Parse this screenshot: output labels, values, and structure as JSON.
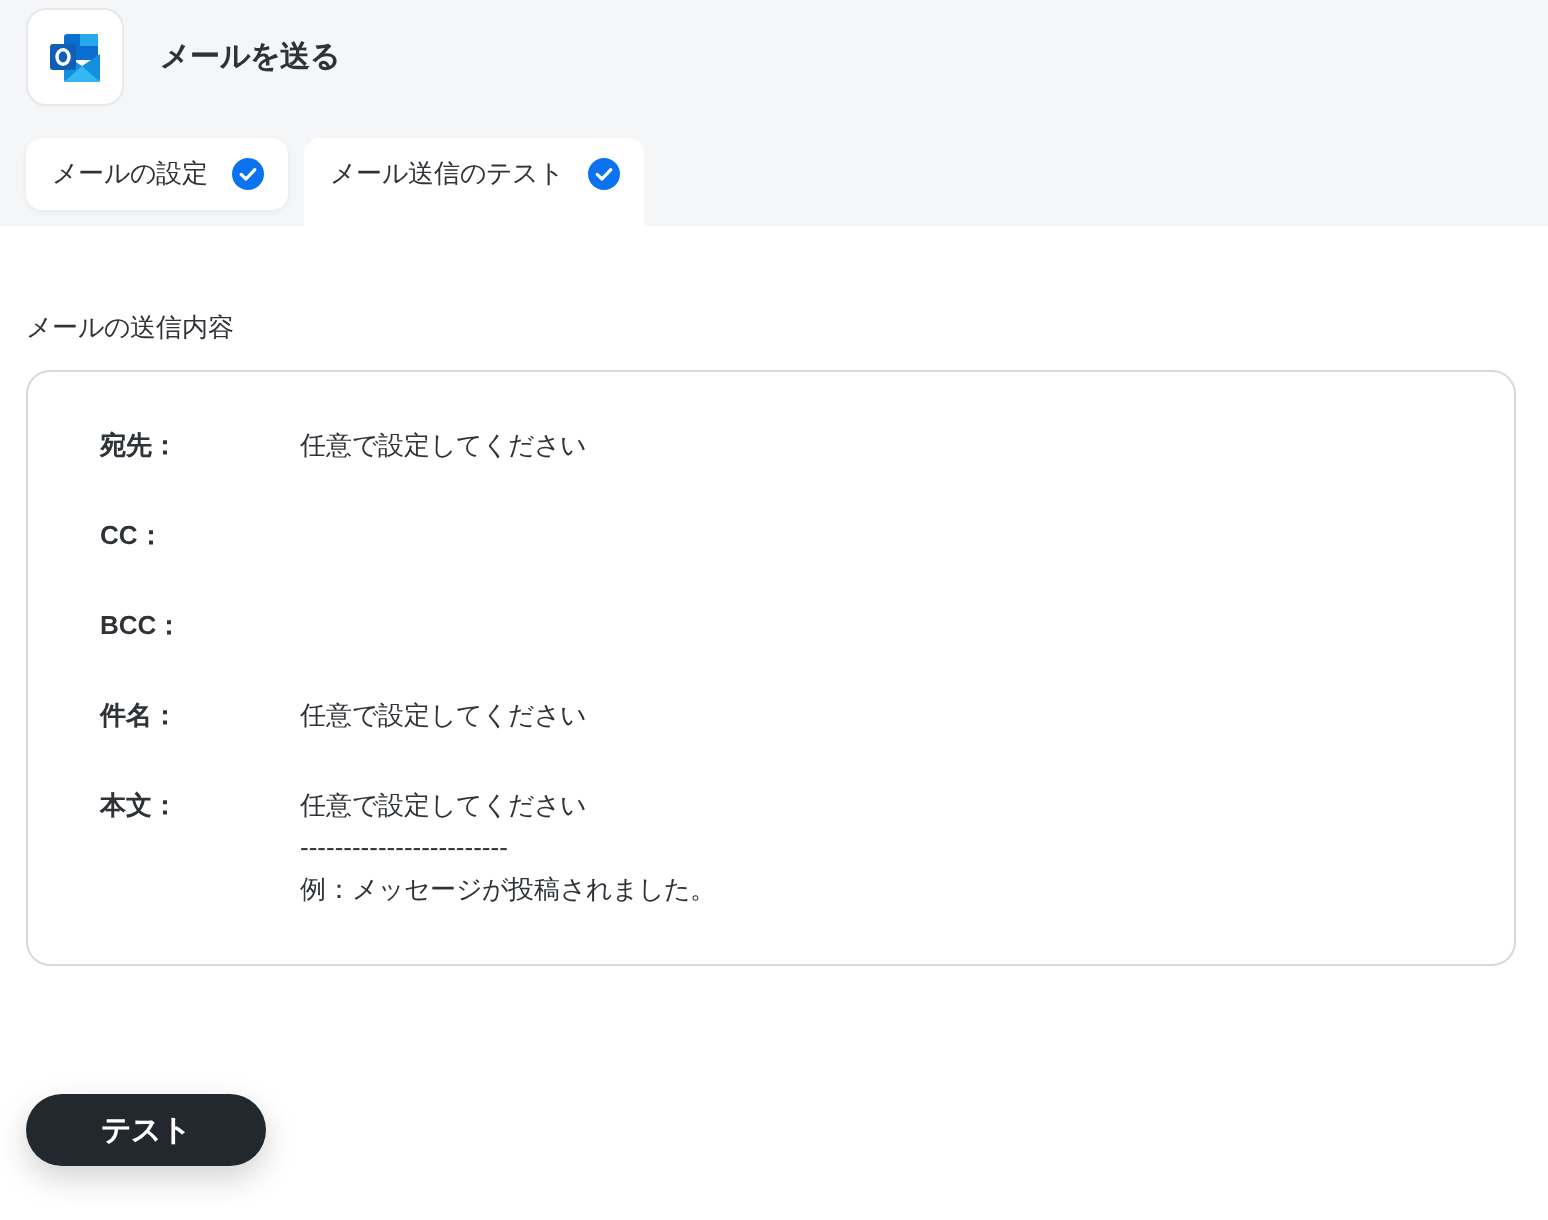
{
  "header": {
    "title": "メールを送る"
  },
  "tabs": [
    {
      "label": "メールの設定",
      "selected": false,
      "done": true
    },
    {
      "label": "メール送信のテスト",
      "selected": true,
      "done": true
    }
  ],
  "section": {
    "title": "メールの送信内容",
    "fields": [
      {
        "label": "宛先：",
        "lines": [
          "任意で設定してください"
        ]
      },
      {
        "label": "CC："
      },
      {
        "label": "BCC："
      },
      {
        "label": "件名：",
        "lines": [
          "任意で設定してください"
        ]
      },
      {
        "label": "本文：",
        "lines": [
          "任意で設定してください",
          "------------------------",
          "例：メッセージが投稿されました。"
        ]
      }
    ]
  },
  "button": {
    "label": "テスト"
  }
}
